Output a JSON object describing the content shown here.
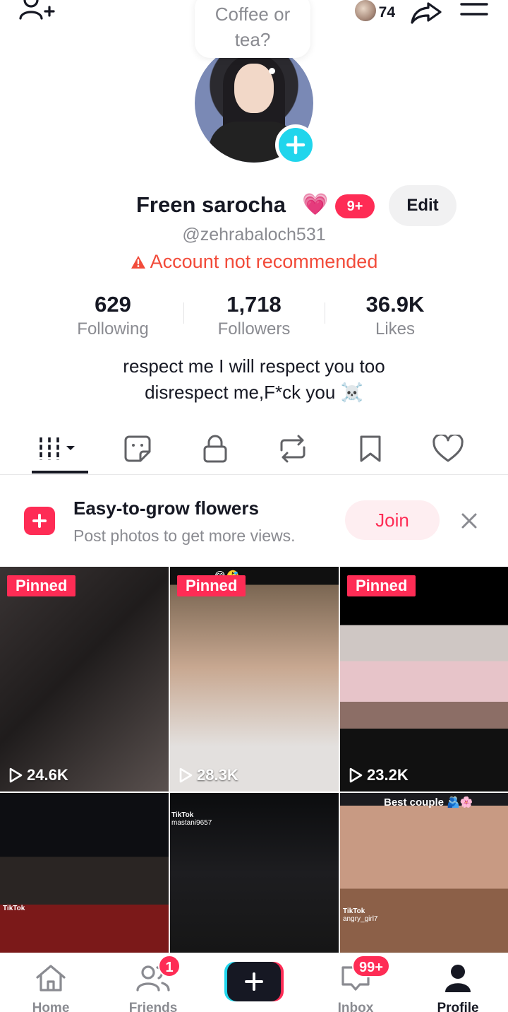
{
  "header": {
    "add_friend_icon": "person-plus-icon",
    "visitor_count": "74",
    "share_icon": "share-arrow-icon",
    "menu_icon": "hamburger-icon"
  },
  "profile": {
    "bubble_text": "Coffee or tea?",
    "name": "Freen sarocha",
    "name_emoji": "💗",
    "badge": "9+",
    "edit_label": "Edit",
    "handle": "@zehrabaloch531",
    "warning": "Account not recommended",
    "stats": [
      {
        "value": "629",
        "label": "Following"
      },
      {
        "value": "1,718",
        "label": "Followers"
      },
      {
        "value": "36.9K",
        "label": "Likes"
      }
    ],
    "bio_line1": "respect me I will respect you too",
    "bio_line2": "disrespect me,F*ck you ☠️"
  },
  "tabs": [
    "videos",
    "stickers",
    "private",
    "reposts",
    "favorites",
    "liked"
  ],
  "promo": {
    "title": "Easy-to-grow flowers",
    "subtitle": "Post photos to get more views.",
    "join_label": "Join"
  },
  "grid": [
    {
      "pinned": "Pinned",
      "views": "24.6K",
      "caption": ""
    },
    {
      "pinned": "Pinned",
      "views": "28.3K",
      "caption": "😂🤣"
    },
    {
      "pinned": "Pinned",
      "views": "23.2K",
      "caption": ""
    },
    {
      "pinned": "",
      "views": "",
      "caption": "",
      "watermark": "TikTok"
    },
    {
      "pinned": "",
      "views": "",
      "caption": "",
      "watermark": "TikTok",
      "user": "mastani9657"
    },
    {
      "pinned": "",
      "views": "",
      "caption": "Best couple 🫂🌸",
      "watermark": "TikTok",
      "user": "angry_girl7"
    }
  ],
  "nav": {
    "home": "Home",
    "friends": "Friends",
    "friends_badge": "1",
    "inbox": "Inbox",
    "inbox_badge": "99+",
    "profile": "Profile"
  },
  "colors": {
    "accent": "#fe2c55",
    "cyan": "#20d5ec",
    "text": "#161823",
    "muted": "#8a8b91",
    "warning": "#f24b3a"
  }
}
